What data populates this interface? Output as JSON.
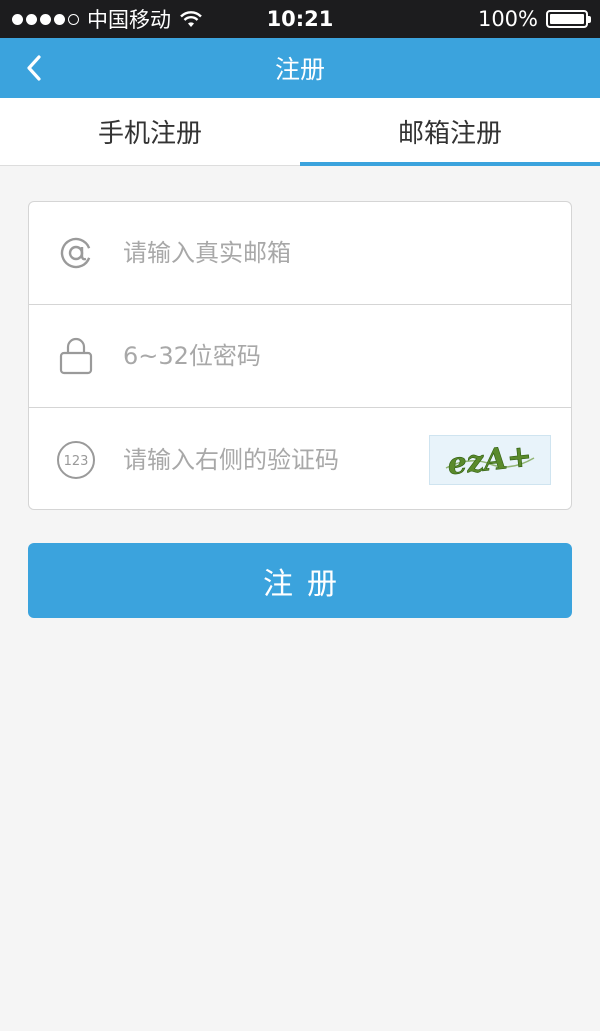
{
  "status_bar": {
    "carrier": "中国移动",
    "time": "10:21",
    "battery": "100%",
    "signal_icon": "signal-dots-icon",
    "wifi_icon": "wifi-icon",
    "battery_icon": "battery-icon"
  },
  "nav": {
    "title": "注册",
    "back_icon": "chevron-left-icon"
  },
  "tabs": [
    {
      "label": "手机注册",
      "active": false
    },
    {
      "label": "邮箱注册",
      "active": true
    }
  ],
  "form": {
    "email": {
      "placeholder": "请输入真实邮箱",
      "value": "",
      "icon": "at-icon"
    },
    "password": {
      "placeholder": "6~32位密码",
      "value": "",
      "icon": "lock-icon"
    },
    "captcha": {
      "placeholder": "请输入右侧的验证码",
      "value": "",
      "icon": "123-icon",
      "image_text": "ezA+"
    }
  },
  "submit": {
    "label": "注册"
  },
  "colors": {
    "accent": "#3ba3dd",
    "status_bar_bg": "#1c1c1e",
    "page_bg": "#f5f5f5",
    "placeholder": "#a8a8a8",
    "border": "#d5d5d5"
  }
}
